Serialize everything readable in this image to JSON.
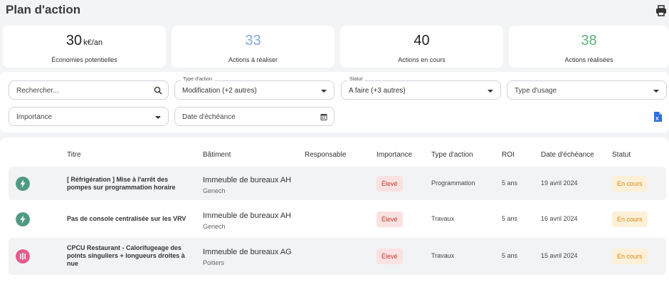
{
  "page": {
    "title": "Plan d'action",
    "print_icon": "printer-icon"
  },
  "kpis": [
    {
      "value": "30",
      "unit": "k€/an",
      "label": "Économies potentielles",
      "color": "#222222"
    },
    {
      "value": "33",
      "unit": "",
      "label": "Actions à réaliser",
      "color": "#7fa9e0"
    },
    {
      "value": "40",
      "unit": "",
      "label": "Actions en cours",
      "color": "#222222"
    },
    {
      "value": "38",
      "unit": "",
      "label": "Actions réalisées",
      "color": "#5fae7d"
    }
  ],
  "filters": {
    "search": {
      "placeholder": "Rechercher..."
    },
    "action_type": {
      "label": "Type d'action",
      "value": "Modification (+2 autres)"
    },
    "status": {
      "label": "Statut",
      "value": "A faire (+3 autres)"
    },
    "usage_type": {
      "placeholder": "Type d'usage"
    },
    "importance": {
      "placeholder": "Importance"
    },
    "due_date": {
      "placeholder": "Date d'échéance"
    },
    "export_icon": "excel-icon"
  },
  "table": {
    "headers": [
      "Titre",
      "Bâtiment",
      "Responsable",
      "Importance",
      "Type d'action",
      "ROI",
      "Date d'échéance",
      "Statut"
    ],
    "rows": [
      {
        "icon": "lightning-icon",
        "icon_color": "#4f9a84",
        "title": "[ Réfrigération ] Mise à l'arrêt des pompes sur programmation horaire",
        "building": "Immeuble de bureaux AH",
        "city": "Genech",
        "responsible": "",
        "importance": "Élevé",
        "action_type": "Programmation",
        "roi": "5 ans",
        "due_date": "19 avril 2024",
        "status": "En cours"
      },
      {
        "icon": "lightning-icon",
        "icon_color": "#4f9a84",
        "title": "Pas de console centralisée sur les VRV",
        "building": "Immeuble de bureaux AH",
        "city": "Genech",
        "responsible": "",
        "importance": "Élevé",
        "action_type": "Travaux",
        "roi": "5 ans",
        "due_date": "16 avril 2024",
        "status": "En cours"
      },
      {
        "icon": "heating-icon",
        "icon_color": "#e8588a",
        "title": "CPCU Restaurant - Calorifugeage des points singuliers + longueurs droites à nue",
        "building": "Immeuble de bureaux AG",
        "city": "Poitiers",
        "responsible": "",
        "importance": "Élevé",
        "action_type": "Travaux",
        "roi": "5 ans",
        "due_date": "15 avril 2024",
        "status": "En cours"
      }
    ]
  }
}
